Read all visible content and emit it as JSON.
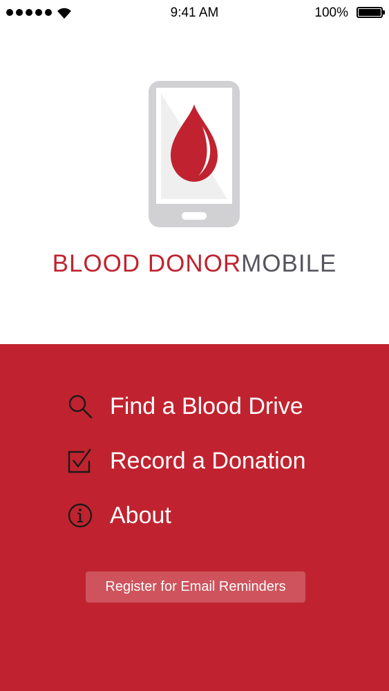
{
  "status_bar": {
    "time": "9:41 AM",
    "battery_percent": "100%",
    "battery_level": 1.0,
    "signal_bars": 5,
    "signal_icon": "signal-dots-icon",
    "wifi_icon": "wifi-icon",
    "battery_icon": "battery-icon"
  },
  "app": {
    "logo_icon": "phone-blood-drop-icon",
    "title_part1": "BLOOD DONOR",
    "title_part2": "MOBILE"
  },
  "menu": {
    "items": [
      {
        "label": "Find a Blood Drive",
        "icon": "search-icon"
      },
      {
        "label": "Record a Donation",
        "icon": "checkbox-icon"
      },
      {
        "label": "About",
        "icon": "info-icon"
      }
    ],
    "register_label": "Register for Email Reminders"
  },
  "colors": {
    "brand_red": "#c0232f",
    "title_gray": "#55555d",
    "phone_gray": "#d1d1d4",
    "menu_text": "#ffffff",
    "icon_stroke": "#1a1a1a"
  }
}
